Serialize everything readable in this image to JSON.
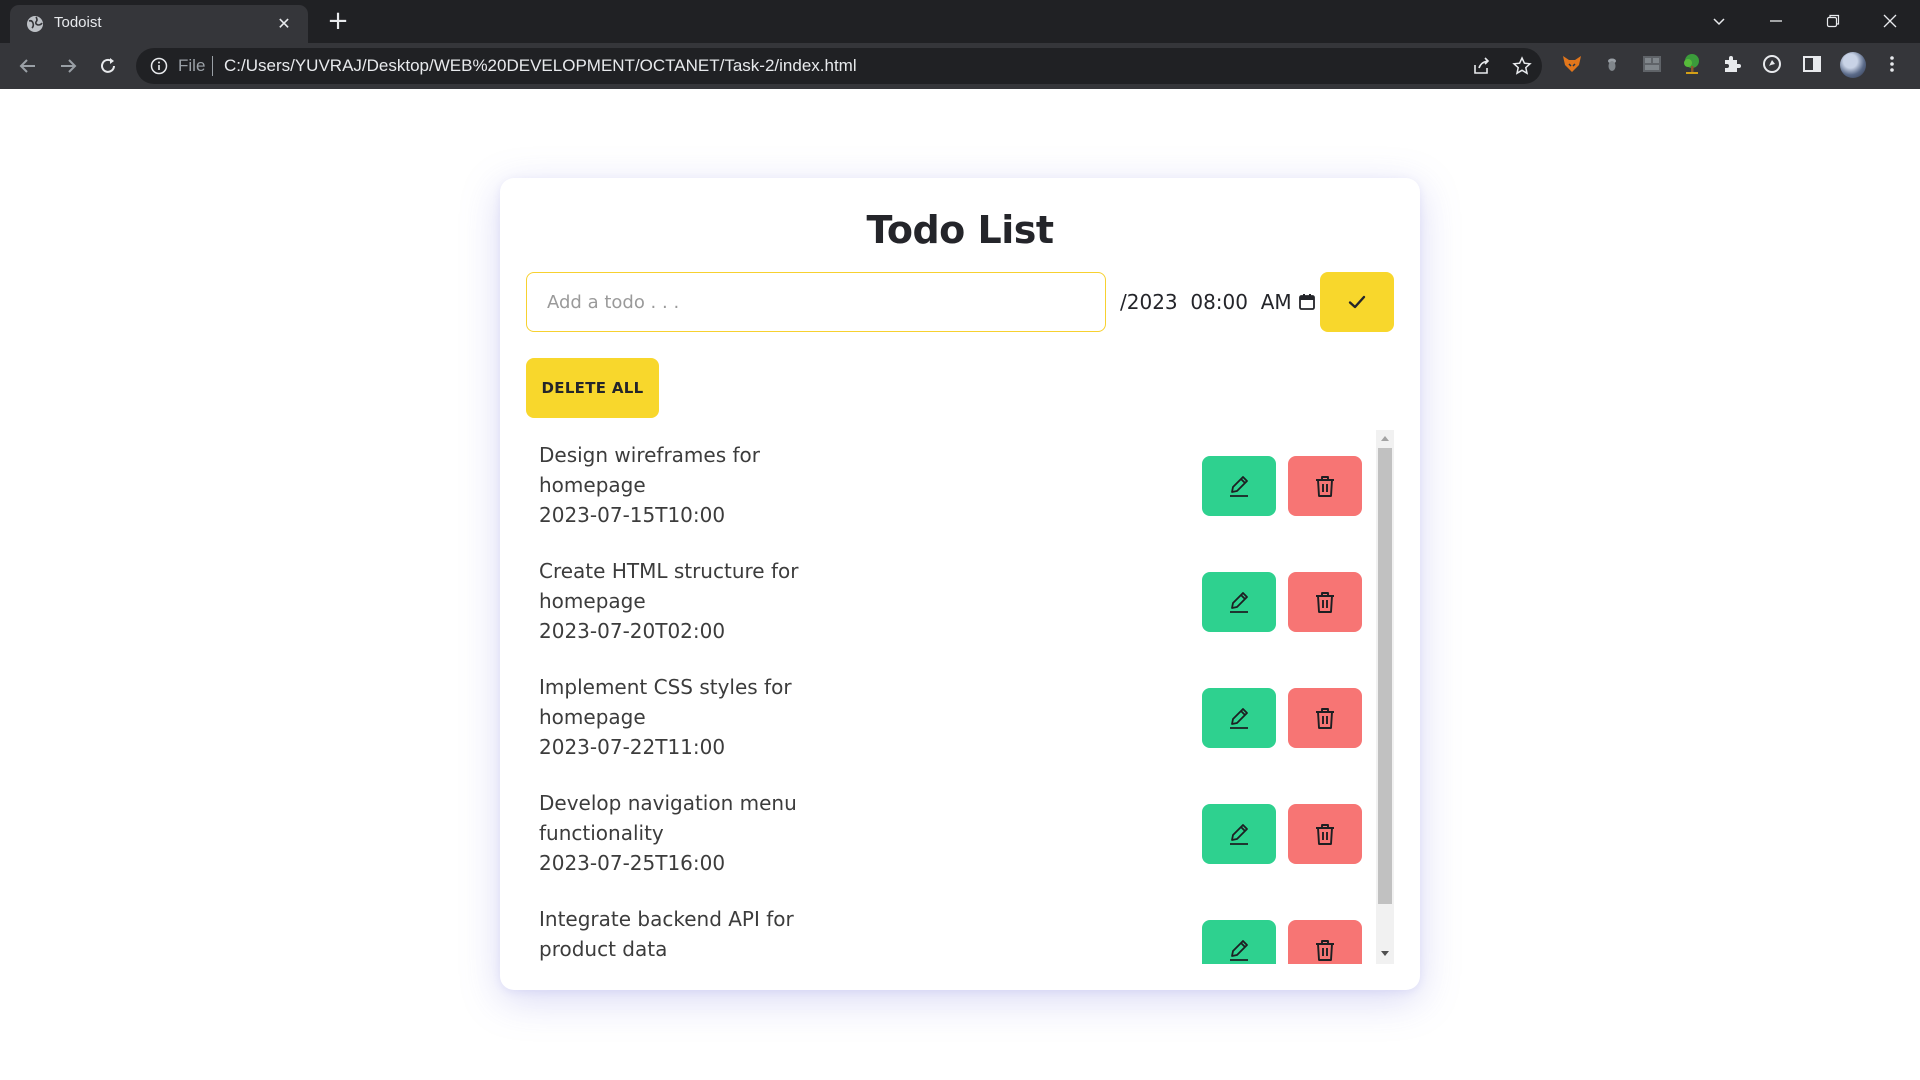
{
  "browser": {
    "tab_title": "Todoist",
    "new_tab_label": "+",
    "close_tab_label": "✕",
    "address_scheme": "File",
    "address_url": "C:/Users/YUVRAJ/Desktop/WEB%20DEVELOPMENT/OCTANET/Task-2/index.html",
    "icons": [
      "globe-icon",
      "back-arrow-icon",
      "forward-arrow-icon",
      "reload-icon",
      "info-icon",
      "share-icon",
      "bookmark-star-icon",
      "fox-extension-icon",
      "acorn-extension-icon",
      "grid-extension-icon",
      "tree-extension-icon",
      "puzzle-extensions-icon",
      "refresh-circle-extension-icon",
      "side-panel-icon",
      "profile-avatar",
      "kebab-menu-icon",
      "tab-search-chevron-icon",
      "minimize-icon",
      "restore-icon",
      "close-window-icon"
    ]
  },
  "app": {
    "title": "Todo List",
    "input_placeholder": "Add a todo . . .",
    "date_value": "/2023  08:00  AM",
    "delete_all_label": "DELETE ALL",
    "colors": {
      "accent_yellow": "#f8d72c",
      "edit_green": "#2ed18f",
      "delete_red": "#f77574",
      "text_dark": "#24252a"
    }
  },
  "todos": [
    {
      "text": "Design wireframes for homepage",
      "date": "2023-07-15T10:00"
    },
    {
      "text": "Create HTML structure for homepage",
      "date": "2023-07-20T02:00"
    },
    {
      "text": "Implement CSS styles for homepage",
      "date": "2023-07-22T11:00"
    },
    {
      "text": "Develop navigation menu functionality",
      "date": "2023-07-25T16:00"
    },
    {
      "text": "Integrate backend API for product data",
      "date": ""
    }
  ]
}
